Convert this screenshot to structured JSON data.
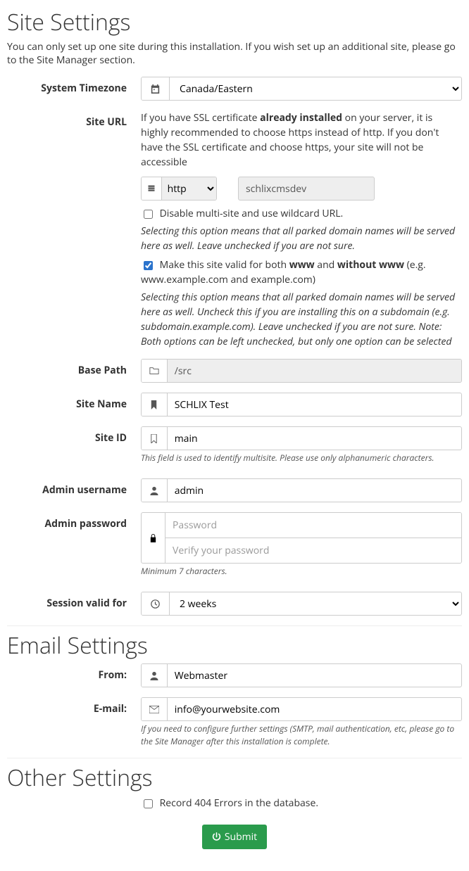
{
  "site_settings": {
    "heading": "Site Settings",
    "intro": "You can only set up one site during this installation. If you wish set up an additional site, please go to the Site Manager section.",
    "timezone": {
      "label": "System Timezone",
      "value": "Canada/Eastern"
    },
    "site_url": {
      "label": "Site URL",
      "info_pre": "If you have SSL certificate ",
      "info_bold": "already installed",
      "info_post": " on your server, it is highly recommended to choose https instead of http. If you don't have the SSL certificate and choose https, your site will not be accessible",
      "protocol": "http",
      "domain": "schlixcmsdev",
      "disable_multisite": {
        "checked": false,
        "label": "Disable multi-site and use wildcard URL.",
        "help": "Selecting this option means that all parked domain names will be served here as well. Leave unchecked if you are not sure."
      },
      "valid_www": {
        "checked": true,
        "label_pre": "Make this site valid for both ",
        "www": "www",
        "and": " and ",
        "without_www": "without www",
        "label_post": " (e.g. www.example.com and example.com)",
        "help": "Selecting this option means that all parked domain names will be served here as well. Uncheck this if you are installing this on a subdomain (e.g. subdomain.example.com). Leave unchecked if you are not sure. Note: Both options can be left unchecked, but only one option can be selected"
      }
    },
    "base_path": {
      "label": "Base Path",
      "value": "/src"
    },
    "site_name": {
      "label": "Site Name",
      "value": "SCHLIX Test"
    },
    "site_id": {
      "label": "Site ID",
      "value": "main",
      "help": "This field is used to identify multisite. Please use only alphanumeric characters."
    },
    "admin_username": {
      "label": "Admin username",
      "value": "admin"
    },
    "admin_password": {
      "label": "Admin password",
      "pw_placeholder": "Password",
      "verify_placeholder": "Verify your password",
      "help": "Minimum 7 characters."
    },
    "session": {
      "label": "Session valid for",
      "value": "2 weeks"
    }
  },
  "email_settings": {
    "heading": "Email Settings",
    "from": {
      "label": "From:",
      "value": "Webmaster"
    },
    "email": {
      "label": "E-mail:",
      "value": "info@yourwebsite.com",
      "help": "If you need to configure further settings (SMTP, mail authentication, etc, please go to the Site Manager after this installation is complete."
    }
  },
  "other_settings": {
    "heading": "Other Settings",
    "record_404": {
      "checked": false,
      "label": "Record 404 Errors in the database."
    },
    "submit_label": " Submit"
  }
}
